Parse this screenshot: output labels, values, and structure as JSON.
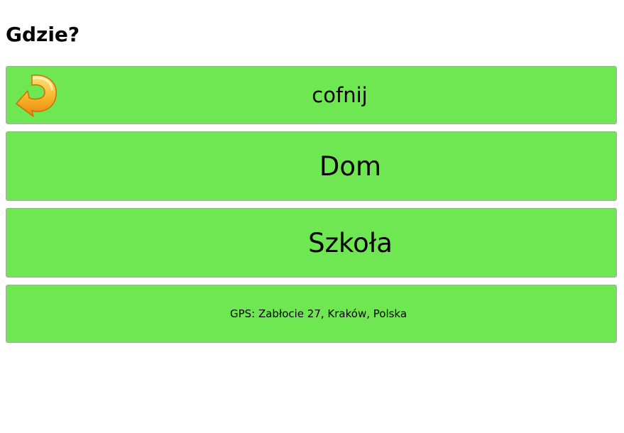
{
  "header": {
    "title": "Gdzie?"
  },
  "buttons": {
    "back": {
      "label": "cofnij",
      "icon": "back-arrow-icon"
    },
    "home": {
      "label": "Dom"
    },
    "school": {
      "label": "Szkoła"
    },
    "gps": {
      "label": "GPS: Zabłocie 27, Kraków, Polska"
    }
  },
  "colors": {
    "button_bg": "#6fe752",
    "button_border": "#a9a9a9",
    "icon_orange": "#f7a21b",
    "icon_yellow": "#ffd84a"
  }
}
